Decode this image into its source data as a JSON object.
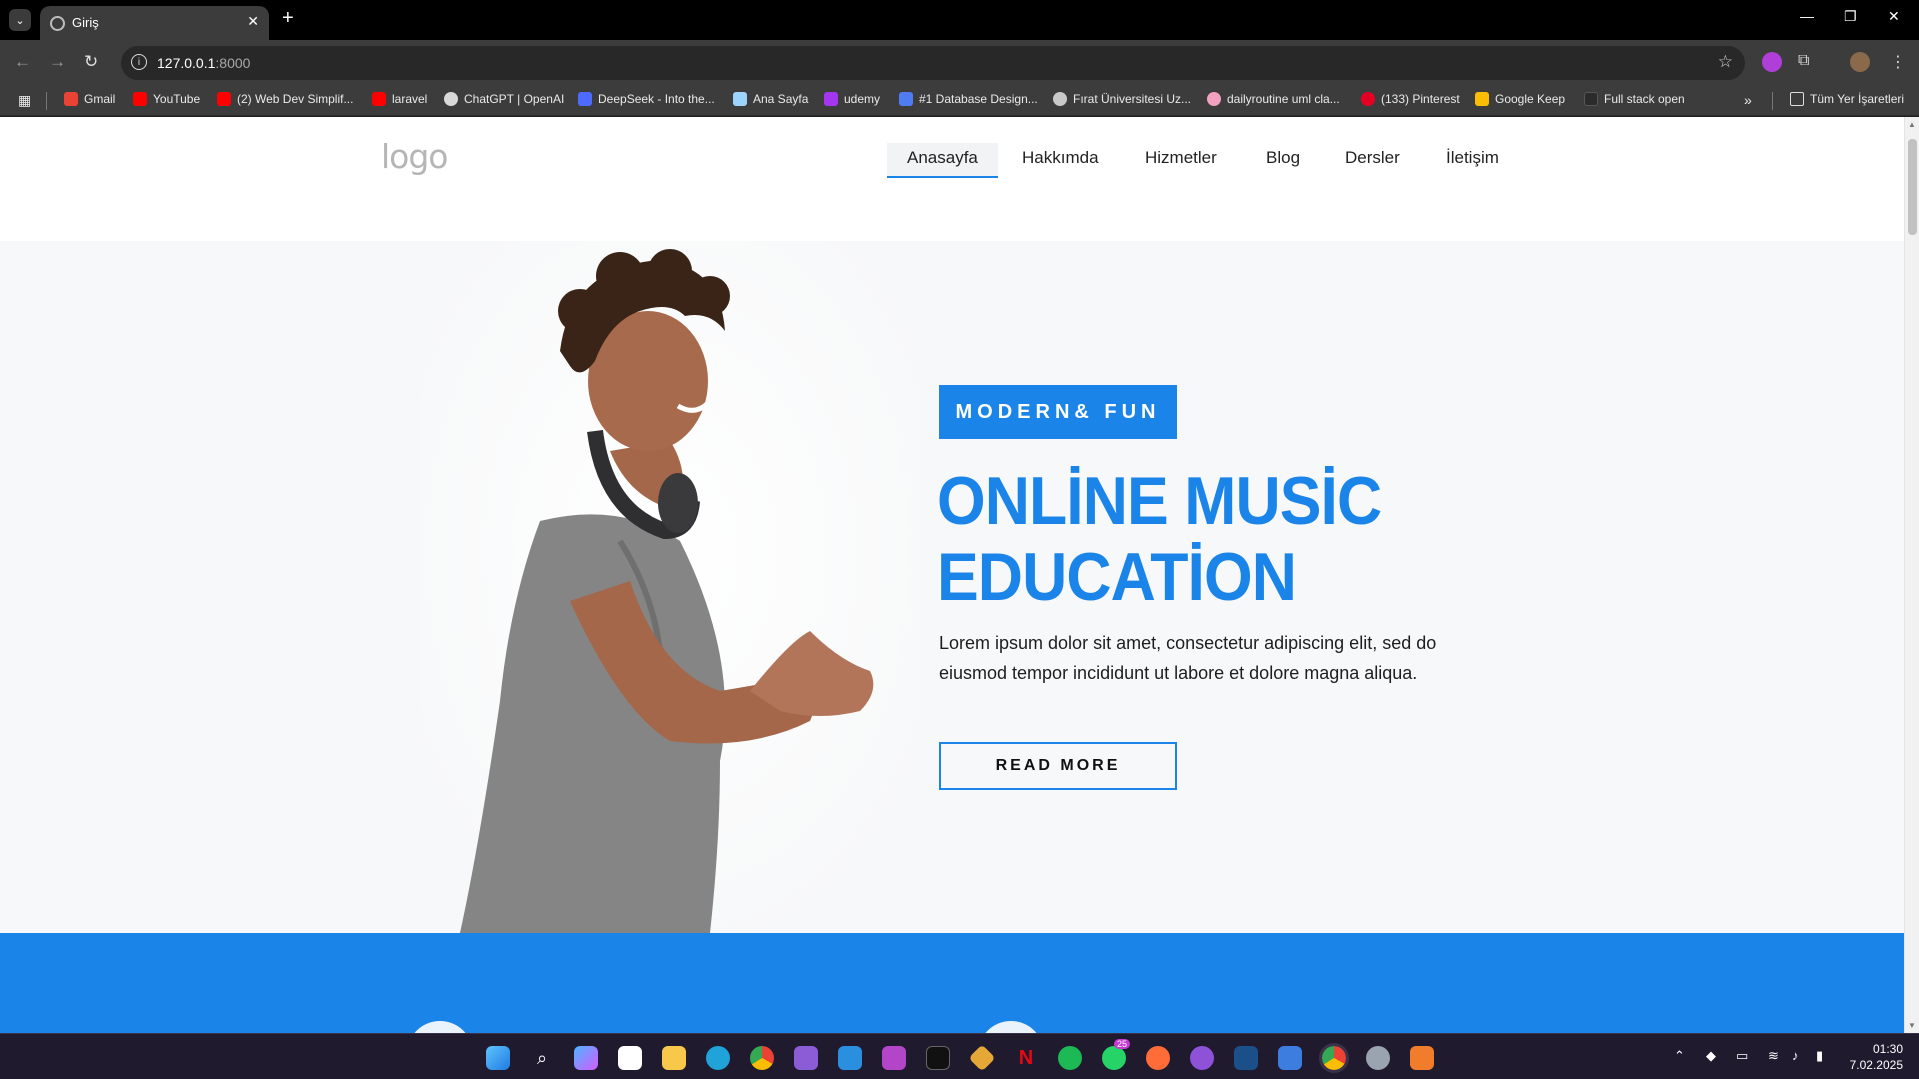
{
  "browser": {
    "tab_title": "Giriş",
    "url_host": "127.0.0.1",
    "url_port": ":8000",
    "bookmarks": [
      {
        "label": "Gmail",
        "color": "#ea4335"
      },
      {
        "label": "YouTube",
        "color": "#ff0000"
      },
      {
        "label": "(2) Web Dev Simplif...",
        "color": "#ff0000"
      },
      {
        "label": "laravel",
        "color": "#ff0000"
      },
      {
        "label": "ChatGPT | OpenAI",
        "color": "#d9d9d9"
      },
      {
        "label": "DeepSeek - Into the...",
        "color": "#4d6bfe"
      },
      {
        "label": "Ana Sayfa",
        "color": "#9bd4ff"
      },
      {
        "label": "udemy",
        "color": "#a435f0"
      },
      {
        "label": "#1 Database Design...",
        "color": "#4f7cf3"
      },
      {
        "label": "Fırat Üniversitesi Uz...",
        "color": "#c9c9c9"
      },
      {
        "label": "dailyroutine uml cla...",
        "color": "#f2a1c1"
      },
      {
        "label": "(133) Pinterest",
        "color": "#e60023"
      },
      {
        "label": "Google Keep",
        "color": "#fbbc04"
      },
      {
        "label": "Full stack open",
        "color": "#2b2b2b"
      }
    ],
    "all_bookmarks": "Tüm Yer İşaretleri"
  },
  "site": {
    "logo": "logo",
    "nav": [
      "Anasayfa",
      "Hakkımda",
      "Hizmetler",
      "Blog",
      "Dersler",
      "İletişim"
    ],
    "hero": {
      "tagline": "MODERN& FUN",
      "title_line1": "ONLİNE MUSİC",
      "title_line2": "EDUCATİON",
      "text": "Lorem ipsum dolor sit amet, consectetur adipiscing elit, sed do eiusmod tempor incididunt ut labore et dolore magna aliqua.",
      "button": "READ MORE"
    }
  },
  "taskbar": {
    "time": "01:30",
    "date": "7.02.2025",
    "whatsapp_badge": "25"
  },
  "colors": {
    "accent": "#1a84e8"
  }
}
